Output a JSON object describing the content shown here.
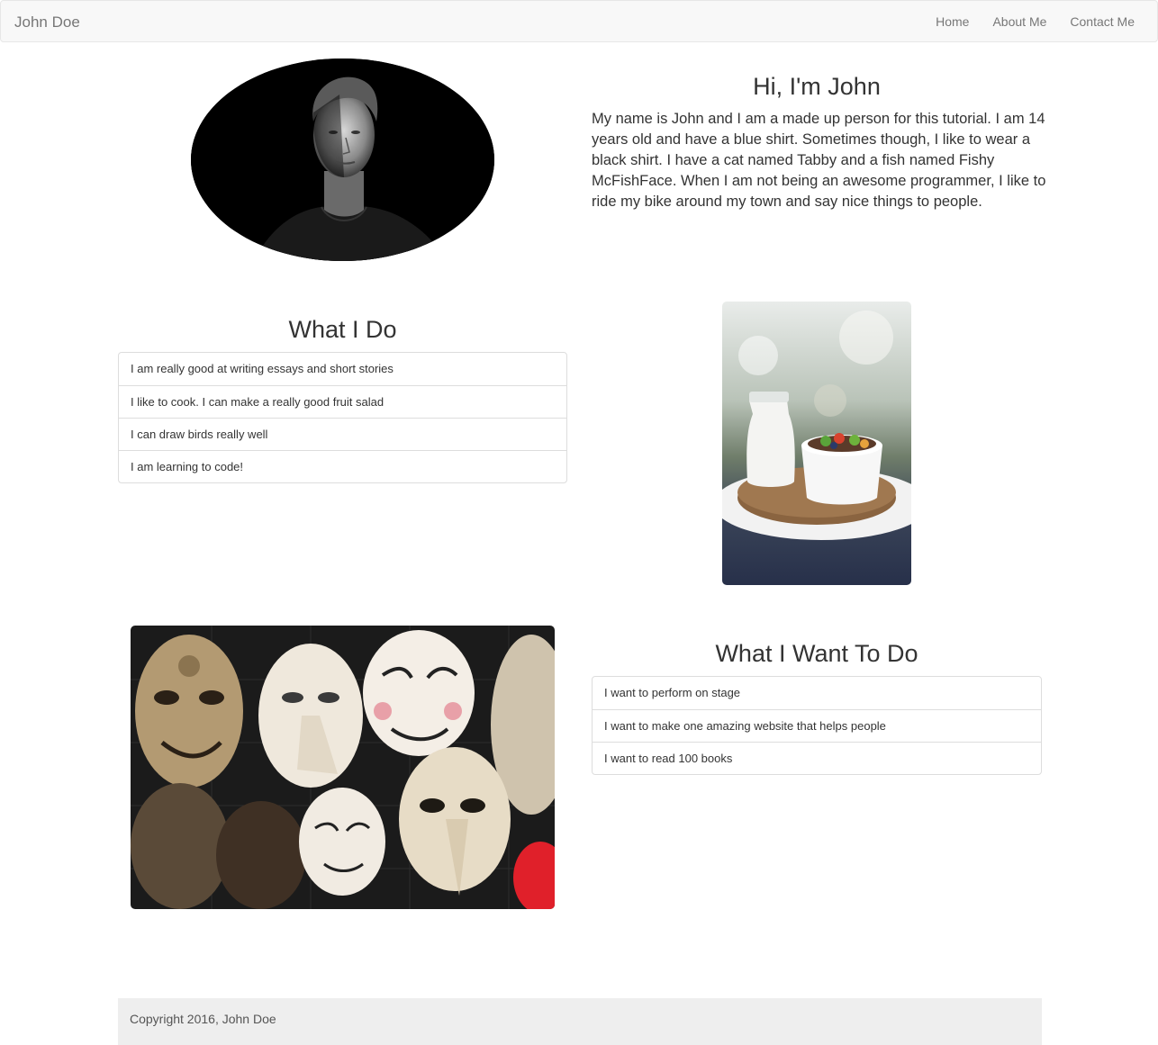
{
  "navbar": {
    "brand": "John Doe",
    "links": [
      "Home",
      "About Me",
      "Contact Me"
    ]
  },
  "hero": {
    "title": "Hi, I'm John",
    "text": "My name is John and I am a made up person for this tutorial. I am 14 years old and have a blue shirt. Sometimes though, I like to wear a black shirt. I have a cat named Tabby and a fish named Fishy McFishFace. When I am not being an awesome programmer, I like to ride my bike around my town and say nice things to people."
  },
  "what_i_do": {
    "title": "What I Do",
    "items": [
      "I am really good at writing essays and short stories",
      "I like to cook. I can make a really good fruit salad",
      "I can draw birds really well",
      "I am learning to code!"
    ]
  },
  "what_i_want": {
    "title": "What I Want To Do",
    "items": [
      "I want to perform on stage",
      "I want to make one amazing website that helps people",
      "I want to read 100 books"
    ]
  },
  "footer": {
    "text": "Copyright 2016, John Doe"
  }
}
